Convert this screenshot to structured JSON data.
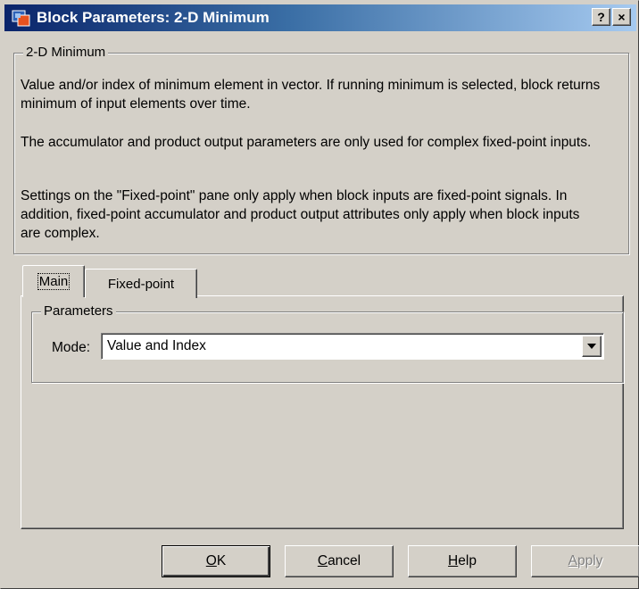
{
  "window": {
    "title": "Block Parameters: 2-D Minimum",
    "help_button": "?",
    "close_button": "×"
  },
  "description": {
    "group_title": "2-D Minimum",
    "paragraphs": [
      "Value and/or index of minimum element in vector. If running minimum is selected, block returns minimum of input elements over time.",
      "The accumulator and product output parameters are only used for complex fixed-point inputs.",
      "Settings on the \"Fixed-point\" pane only apply when block inputs are fixed-point signals. In addition, fixed-point accumulator and product output attributes only apply when block inputs are complex."
    ]
  },
  "tabs": [
    {
      "label": "Main",
      "selected": true
    },
    {
      "label": "Fixed-point",
      "selected": false
    }
  ],
  "parameters": {
    "group_title": "Parameters",
    "mode_label": "Mode:",
    "mode_value": "Value and Index"
  },
  "buttons": {
    "ok": {
      "mnemonic": "O",
      "rest": "K"
    },
    "cancel": {
      "mnemonic": "C",
      "rest": "ancel"
    },
    "help": {
      "mnemonic": "H",
      "rest": "elp"
    },
    "apply": {
      "mnemonic": "A",
      "rest": "pply",
      "enabled": false
    }
  },
  "colors": {
    "dialog_bg": "#d4d0c8",
    "titlebar_start": "#0a246a",
    "titlebar_end": "#a6caf0",
    "disabled_text": "#808080"
  },
  "icons": {
    "title": "simulink-block-icon",
    "dropdown": "dropdown-arrow-icon"
  }
}
